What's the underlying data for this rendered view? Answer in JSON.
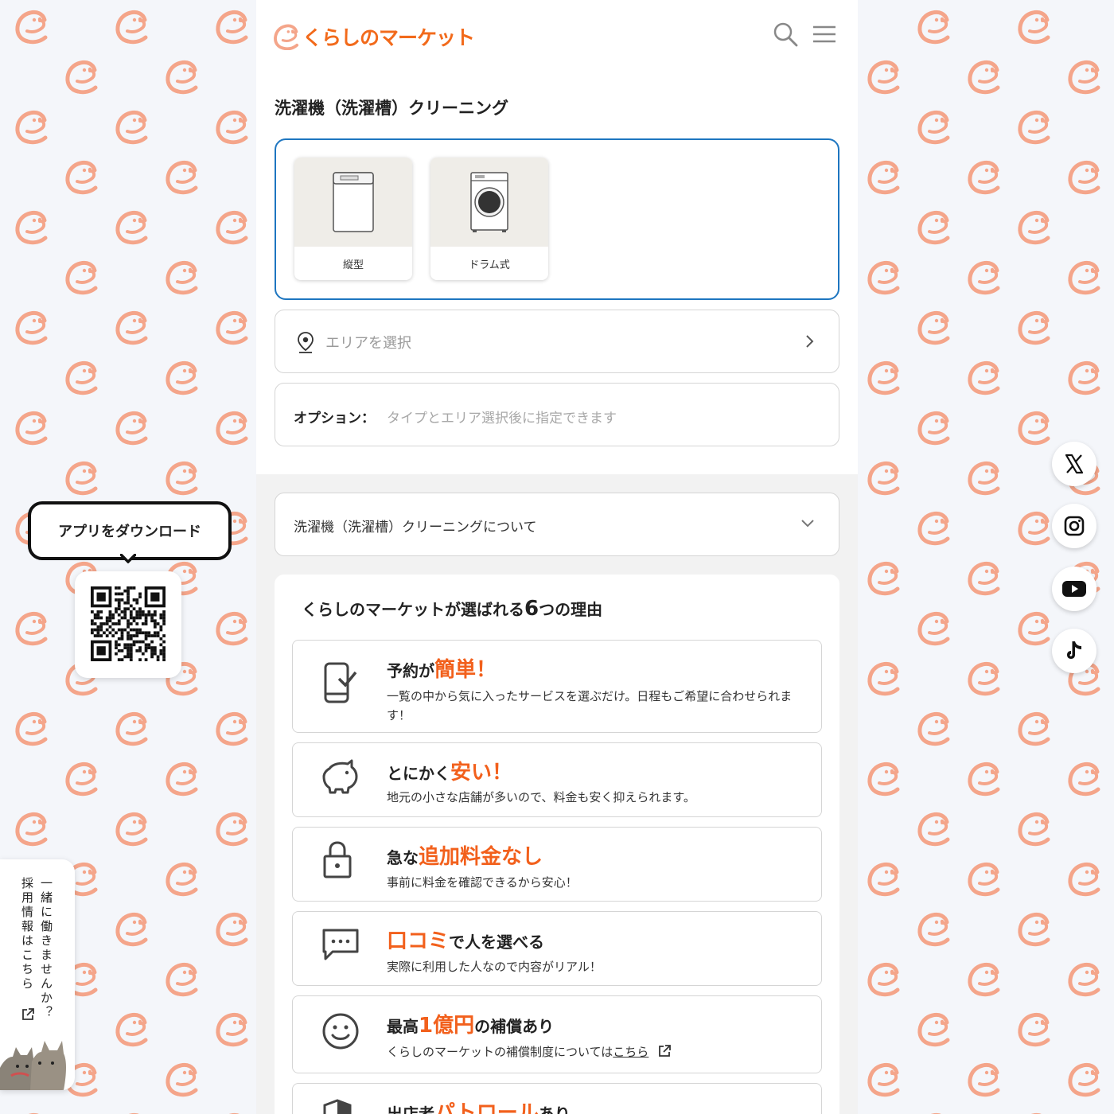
{
  "header": {
    "logo_text": "くらしのマーケット",
    "search_icon": "search-icon",
    "menu_icon": "hamburger-menu-icon"
  },
  "service": {
    "title": "洗濯機（洗濯槽）クリーニング",
    "types": [
      {
        "label": "縦型",
        "icon": "top-load-washer-image"
      },
      {
        "label": "ドラム式",
        "icon": "drum-washer-image"
      }
    ]
  },
  "area": {
    "placeholder": "エリアを選択",
    "icon": "location-pin-icon"
  },
  "option": {
    "label": "オプション：",
    "hint": "タイプとエリア選択後に指定できます"
  },
  "about": {
    "label": "洗濯機（洗濯槽）クリーニングについて"
  },
  "reasons": {
    "title_prefix": "くらしのマーケットが選ばれる",
    "title_number": "6",
    "title_suffix": "つの理由",
    "items": [
      {
        "pre": "予約が",
        "hl": "簡単！",
        "post": "",
        "desc": "一覧の中から気に入ったサービスを選ぶだけ。日程もご希望に合わせられます！",
        "icon": "phone-check-icon"
      },
      {
        "pre": "とにかく",
        "hl": "安い！",
        "post": "",
        "desc": "地元の小さな店舗が多いので、料金も安く抑えられます。",
        "icon": "piggy-bank-icon"
      },
      {
        "pre": "急な",
        "hl": "追加料金なし",
        "post": "",
        "desc": "事前に料金を確認できるから安心！",
        "icon": "lock-icon"
      },
      {
        "pre": "",
        "hl": "口コミ",
        "post": "で人を選べる",
        "desc": "実際に利用した人なので内容がリアル！",
        "icon": "chat-bubble-icon"
      },
      {
        "pre": "最高",
        "hl": "1億円",
        "post": "の補償あり",
        "desc": "くらしのマーケットの補償制度については",
        "link": "こちら",
        "icon": "smile-icon"
      },
      {
        "pre": "出店者",
        "hl": "パトロール",
        "post": "あり",
        "desc": "",
        "icon": "shield-icon"
      }
    ]
  },
  "app_download": {
    "label": "アプリをダウンロード",
    "qr": "qr-code"
  },
  "recruit": {
    "line1": "一緒に働きませんか？",
    "line2": "採用情報はこちら"
  },
  "social": [
    {
      "name": "x-icon"
    },
    {
      "name": "instagram-icon"
    },
    {
      "name": "youtube-icon"
    },
    {
      "name": "tiktok-icon"
    }
  ],
  "colors": {
    "brand_orange": "#f26a1b",
    "pattern_orange": "#f4a58a",
    "selected_border": "#1e76c0",
    "background": "#f4f6fa"
  }
}
